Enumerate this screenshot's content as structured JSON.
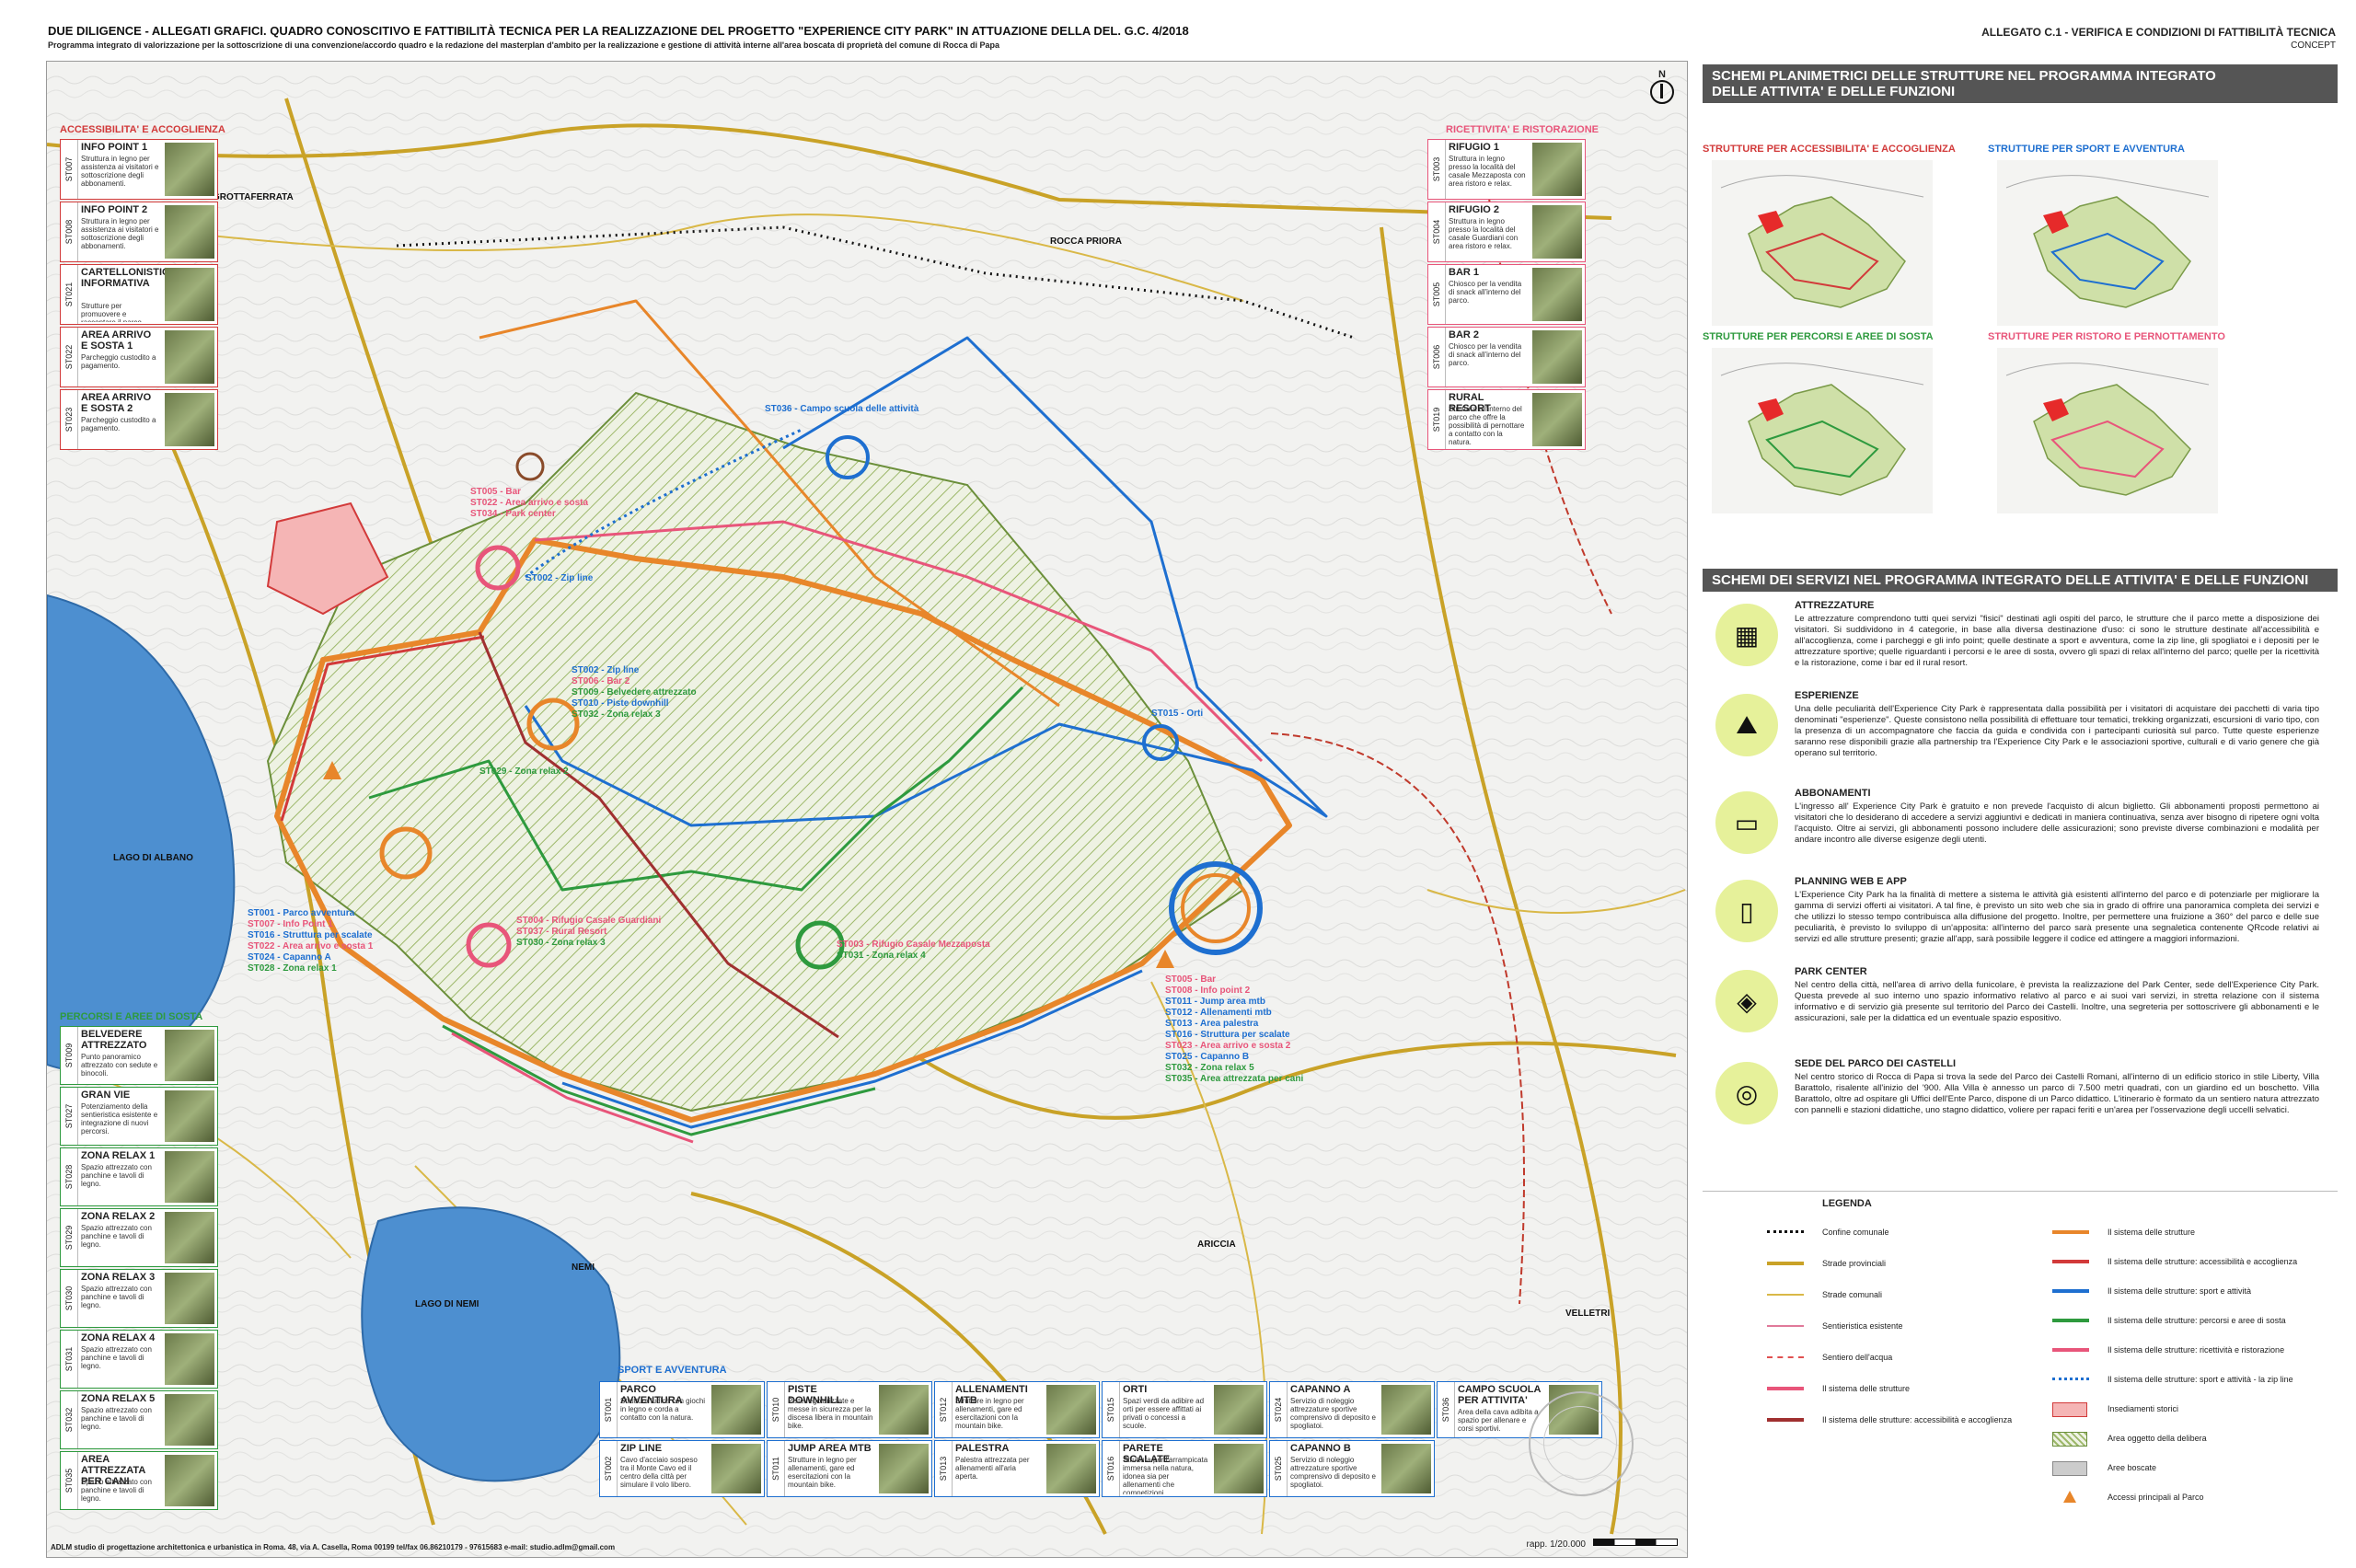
{
  "header": {
    "title": "DUE DILIGENCE - ALLEGATI GRAFICI. QUADRO CONOSCITIVO E FATTIBILITÀ TECNICA PER LA REALIZZAZIONE DEL PROGETTO \"EXPERIENCE CITY PARK\" IN ATTUAZIONE DELLA DEL. G.C. 4/2018",
    "subtitle": "Programma integrato di valorizzazione per la sottoscrizione di una convenzione/accordo quadro e la redazione del masterplan d'ambito per la realizzazione e gestione di attività interne all'area boscata di proprietà del comune di Rocca di Papa",
    "allegato": "ALLEGATO C.1 - VERIFICA E CONDIZIONI DI FATTIBILITÀ TECNICA",
    "concept": "CONCEPT"
  },
  "map": {
    "north": "N",
    "places": [
      "GROTTAFERRATA",
      "ROCCA PRIORA",
      "LAGO DI ALBANO",
      "ARICCIA",
      "NEMI",
      "LAGO DI NEMI",
      "VELLETRI"
    ],
    "annotations": [
      {
        "text": "ST005 - Bar",
        "color": "#e8557a"
      },
      {
        "text": "ST022 - Area arrivo e sosta",
        "color": "#e8557a"
      },
      {
        "text": "ST034 - Park center",
        "color": "#e8557a"
      },
      {
        "text": "ST002 - Zip line",
        "color": "#1e6fd0"
      },
      {
        "text": "ST036 - Campo scuola delle attività",
        "color": "#1e6fd0"
      },
      {
        "text": "ST002 - Zip line",
        "color": "#1e6fd0"
      },
      {
        "text": "ST006 - Bar 2",
        "color": "#e8557a"
      },
      {
        "text": "ST009 - Belvedere attrezzato",
        "color": "#2e9a3e"
      },
      {
        "text": "ST010 - Piste downhill",
        "color": "#1e6fd0"
      },
      {
        "text": "ST032 - Zona relax 3",
        "color": "#2e9a3e"
      },
      {
        "text": "ST029 - Zona relax 2",
        "color": "#2e9a3e"
      },
      {
        "text": "ST015 - Orti",
        "color": "#1e6fd0"
      },
      {
        "text": "ST001 - Parco avventura",
        "color": "#1e6fd0"
      },
      {
        "text": "ST007 - Info Point 1",
        "color": "#e8557a"
      },
      {
        "text": "ST016 - Struttura per scalate",
        "color": "#1e6fd0"
      },
      {
        "text": "ST022 - Area arrivo e sosta 1",
        "color": "#e8557a"
      },
      {
        "text": "ST024 - Capanno A",
        "color": "#1e6fd0"
      },
      {
        "text": "ST028 - Zona relax 1",
        "color": "#2e9a3e"
      },
      {
        "text": "ST004 - Rifugio Casale Guardiani",
        "color": "#e8557a"
      },
      {
        "text": "ST037 - Rural Resort",
        "color": "#e8557a"
      },
      {
        "text": "ST030 - Zona relax 3",
        "color": "#2e9a3e"
      },
      {
        "text": "ST003 - Rifugio Casale Mezzaposta",
        "color": "#e8557a"
      },
      {
        "text": "ST031 - Zona relax 4",
        "color": "#2e9a3e"
      },
      {
        "text": "ST005 - Bar",
        "color": "#e8557a"
      },
      {
        "text": "ST008 - Info point 2",
        "color": "#e8557a"
      },
      {
        "text": "ST011 - Jump area mtb",
        "color": "#1e6fd0"
      },
      {
        "text": "ST012 - Allenamenti mtb",
        "color": "#1e6fd0"
      },
      {
        "text": "ST013 - Area palestra",
        "color": "#1e6fd0"
      },
      {
        "text": "ST016 - Struttura per scalate",
        "color": "#1e6fd0"
      },
      {
        "text": "ST023 - Area arrivo e sosta 2",
        "color": "#e8557a"
      },
      {
        "text": "ST025 - Capanno B",
        "color": "#1e6fd0"
      },
      {
        "text": "ST032 - Zona relax 5",
        "color": "#2e9a3e"
      },
      {
        "text": "ST035 - Area attrezzata per cani",
        "color": "#2e9a3e"
      }
    ],
    "groups": {
      "accessibilita": {
        "title": "ACCESSIBILITA' E ACCOGLIENZA",
        "color": "#d23a3a",
        "cards": [
          {
            "code": "ST007",
            "title": "INFO POINT 1",
            "desc": "Struttura in legno per assistenza ai visitatori e sottoscrizione degli abbonamenti."
          },
          {
            "code": "ST008",
            "title": "INFO POINT 2",
            "desc": "Struttura in legno per assistenza ai visitatori e sottoscrizione degli abbonamenti."
          },
          {
            "code": "ST021",
            "title": "CARTELLONISTICA INFORMATIVA",
            "desc": "Strutture per promuovere e raccontare il parco."
          },
          {
            "code": "ST022",
            "title": "AREA ARRIVO E SOSTA 1",
            "desc": "Parcheggio custodito a pagamento."
          },
          {
            "code": "ST023",
            "title": "AREA ARRIVO E SOSTA 2",
            "desc": "Parcheggio custodito a pagamento."
          }
        ]
      },
      "ricettivita": {
        "title": "RICETTIVITA' E RISTORAZIONE",
        "color": "#e8557a",
        "cards": [
          {
            "code": "ST003",
            "title": "RIFUGIO 1",
            "desc": "Struttura in legno presso la località del casale Mezzaposta con area ristoro e relax."
          },
          {
            "code": "ST004",
            "title": "RIFUGIO 2",
            "desc": "Struttura in legno presso la località del casale Guardiani con area ristoro e relax."
          },
          {
            "code": "ST005",
            "title": "BAR 1",
            "desc": "Chiosco per la vendita di snack all'interno del parco."
          },
          {
            "code": "ST006",
            "title": "BAR 2",
            "desc": "Chiosco per la vendita di snack all'interno del parco."
          },
          {
            "code": "ST019",
            "title": "RURAL RESORT",
            "desc": "Struttura all'interno del parco che offre la possibilità di pernottare a contatto con la natura."
          }
        ]
      },
      "percorsi": {
        "title": "PERCORSI E AREE DI SOSTA",
        "color": "#2e9a3e",
        "cards": [
          {
            "code": "ST009",
            "title": "BELVEDERE ATTREZZATO",
            "desc": "Punto panoramico attrezzato con sedute e binocoli."
          },
          {
            "code": "ST027",
            "title": "GRAN VIE",
            "desc": "Potenziamento della sentieristica esistente e integrazione di nuovi percorsi."
          },
          {
            "code": "ST028",
            "title": "ZONA RELAX 1",
            "desc": "Spazio attrezzato con panchine e tavoli di legno."
          },
          {
            "code": "ST029",
            "title": "ZONA RELAX 2",
            "desc": "Spazio attrezzato con panchine e tavoli di legno."
          },
          {
            "code": "ST030",
            "title": "ZONA RELAX 3",
            "desc": "Spazio attrezzato con panchine e tavoli di legno."
          },
          {
            "code": "ST031",
            "title": "ZONA RELAX 4",
            "desc": "Spazio attrezzato con panchine e tavoli di legno."
          },
          {
            "code": "ST032",
            "title": "ZONA RELAX 5",
            "desc": "Spazio attrezzato con panchine e tavoli di legno."
          },
          {
            "code": "ST035",
            "title": "AREA ATTREZZATA PER CANI",
            "desc": "Spazio attrezzato con panchine e tavoli di legno."
          }
        ]
      },
      "sport": {
        "title": "SPORT E AVVENTURA",
        "color": "#1e6fd0",
        "cards": [
          {
            "code": "ST001",
            "title": "PARCO AVVENTURA",
            "desc": "Struttura ludica con giochi in legno e corda a contatto con la natura."
          },
          {
            "code": "ST002",
            "title": "ZIP LINE",
            "desc": "Cavo d'acciaio sospeso tra il Monte Cavo ed il centro della città per simulare il volo libero."
          },
          {
            "code": "ST010",
            "title": "PISTE DOWNHILL",
            "desc": "Piste regolarizzate e messe in sicurezza per la discesa libera in mountain bike."
          },
          {
            "code": "ST011",
            "title": "JUMP AREA MTB",
            "desc": "Strutture in legno per allenamenti, gare ed esercitazioni con la mountain bike."
          },
          {
            "code": "ST012",
            "title": "ALLENAMENTI MTB",
            "desc": "Strutture in legno per allenamenti, gare ed esercitazioni con la mountain bike."
          },
          {
            "code": "ST013",
            "title": "PALESTRA",
            "desc": "Palestra attrezzata per allenamenti all'aria aperta."
          },
          {
            "code": "ST015",
            "title": "ORTI",
            "desc": "Spazi verdi da adibire ad orti per essere affittati ai privati o concessi a scuole."
          },
          {
            "code": "ST016",
            "title": "PARETE SCALATE",
            "desc": "Struttura per l'arrampicata immersa nella natura, idonea sia per allenamenti che competizioni."
          },
          {
            "code": "ST024",
            "title": "CAPANNO A",
            "desc": "Servizio di noleggio attrezzature sportive comprensivo di deposito e spogliatoi."
          },
          {
            "code": "ST025",
            "title": "CAPANNO B",
            "desc": "Servizio di noleggio attrezzature sportive comprensivo di deposito e spogliatoi."
          },
          {
            "code": "ST036",
            "title": "CAMPO SCUOLA PER ATTIVITA'",
            "desc": "Area della cava adibita a spazio per allenare e corsi sportivi."
          }
        ]
      }
    },
    "footer_studio": "ADLM studio di progettazione architettonica e urbanistica in Roma. 48, via A. Casella, Roma 00199 tel/fax 06.86210179 - 97615683 e-mail: studio.adlm@gmail.com",
    "scale": "rapp. 1/20.000"
  },
  "right": {
    "schemi_title_1": "SCHEMI PLANIMETRICI DELLE STRUTTURE NEL PROGRAMMA INTEGRATO",
    "schemi_title_2": "DELLE ATTIVITA' E DELLE FUNZIONI",
    "mini_maps": [
      {
        "label": "STRUTTURE PER ACCESSIBILITA' E ACCOGLIENZA",
        "color": "#d23a3a"
      },
      {
        "label": "STRUTTURE PER SPORT E AVVENTURA",
        "color": "#1e6fd0"
      },
      {
        "label": "STRUTTURE PER PERCORSI E AREE DI SOSTA",
        "color": "#2e9a3e"
      },
      {
        "label": "STRUTTURE PER RISTORO E PERNOTTAMENTO",
        "color": "#e8557a"
      }
    ],
    "servizi_title": "SCHEMI DEI SERVIZI NEL PROGRAMMA INTEGRATO DELLE ATTIVITA' E DELLE FUNZIONI",
    "services": [
      {
        "title": "ATTREZZATURE",
        "icon": "market-stall-icon",
        "text": "Le attrezzature comprendono tutti quei servizi \"fisici\" destinati agli ospiti del parco, le strutture che il parco mette a disposizione dei visitatori. Si suddividono in 4 categorie, in base alla diversa destinazione d'uso: ci sono le strutture destinate all'accessibilità e all'accoglienza, come i parcheggi e gli info point; quelle destinate a sport e avventura, come la zip line, gli spogliatoi e i depositi per le attrezzature sportive; quelle riguardanti i percorsi e le aree di sosta, ovvero gli spazi di relax all'interno del parco; quelle per la ricettività e la ristorazione, come i bar ed il rural resort."
      },
      {
        "title": "ESPERIENZE",
        "icon": "hiker-icon",
        "text": "Una delle peculiarità dell'Experience City Park è rappresentata dalla possibilità per i visitatori di acquistare dei pacchetti di varia tipo denominati \"esperienze\". Queste consistono nella possibilità di effettuare tour tematici, trekking organizzati, escursioni di vario tipo, con la presenza di un accompagnatore che faccia da guida e condivida con i partecipanti curiosità sul parco. Tutte queste esperienze saranno rese disponibili grazie alla partnership tra l'Experience City Park e le associazioni sportive, culturali e di vario genere che già operano sul territorio."
      },
      {
        "title": "ABBONAMENTI",
        "icon": "cards-icon",
        "text": "L'ingresso all' Experience City Park è gratuito e non prevede l'acquisto di alcun biglietto. Gli abbonamenti proposti permettono ai visitatori che lo desiderano di accedere a servizi aggiuntivi e dedicati in maniera continuativa, senza aver bisogno di ripetere ogni volta l'acquisto. Oltre ai servizi, gli abbonamenti possono includere delle assicurazioni; sono previste diverse combinazioni e modalità per andare incontro alle diverse esigenze degli utenti."
      },
      {
        "title": "PLANNING WEB E APP",
        "icon": "smartphone-icon",
        "text": "L'Experience City Park ha la finalità di mettere a sistema le attività già esistenti all'interno del parco e di potenziarle per migliorare la gamma di servizi offerti ai visitatori. A tal fine, è previsto un sito web che sia in grado di offrire una panoramica completa dei servizi e che utilizzi lo stesso tempo contribuisca alla diffusione del progetto. Inoltre, per permettere una fruizione a 360° del parco e delle sue peculiarità, è previsto lo sviluppo di un'apposita: all'interno del parco sarà presente una segnaletica contenente QRcode relativi ai servizi ed alle strutture presenti; grazie all'app, sarà possibile leggere il codice ed attingere a maggiori informazioni."
      },
      {
        "title": "PARK CENTER",
        "icon": "park-center-icon",
        "text": "Nel centro della città, nell'area di arrivo della funicolare, è prevista la realizzazione del Park Center, sede dell'Experience City Park. Questa prevede al suo interno uno spazio informativo relativo al parco e ai suoi vari servizi, in stretta relazione con il sistema informativo e di servizio già presente sul territorio del Parco dei Castelli. Inoltre, una segreteria per sottoscrivere gli abbonamenti e le assicurazioni, sale per la didattica ed un eventuale spazio espositivo."
      },
      {
        "title": "SEDE DEL PARCO DEI CASTELLI",
        "icon": "parco-castelli-logo-icon",
        "text": "Nel centro storico di Rocca di Papa si trova la sede del Parco dei Castelli Romani, all'interno di un edificio storico in stile Liberty, Villa Barattolo, risalente all'inizio del '900. Alla Villa è annesso un parco di 7.500 metri quadrati, con un giardino ed un boschetto. Villa Barattolo, oltre ad ospitare gli Uffici dell'Ente Parco, dispone di un Parco didattico. L'itinerario è formato da un sentiero natura attrezzato con pannelli e stazioni didattiche, uno stagno didattico, voliere per rapaci feriti e un'area per l'osservazione degli uccelli selvatici."
      }
    ],
    "legenda_title": "LEGENDA",
    "legend_left": [
      {
        "label": "Confine comunale",
        "color": "#111111",
        "style": "dotted"
      },
      {
        "label": "Strade provinciali",
        "color": "#c9a227",
        "style": "thick"
      },
      {
        "label": "Strade comunali",
        "color": "#d9b847",
        "style": "thin"
      },
      {
        "label": "Sentieristica esistente",
        "color": "#e07a9a",
        "style": "thin"
      },
      {
        "label": "Sentiero dell'acqua",
        "color": "#e05050",
        "style": "dashed"
      },
      {
        "label": "Il sistema delle strutture",
        "color": "#e8557a",
        "style": "thick"
      },
      {
        "label": "Il sistema delle strutture: accessibilità e accoglienza",
        "color": "#a03030",
        "style": "thick"
      }
    ],
    "legend_right": [
      {
        "label": "Il sistema delle strutture",
        "color": "#e8862a",
        "style": "thick"
      },
      {
        "label": "Il sistema delle strutture: accessibilità e accoglienza",
        "color": "#d23a3a",
        "style": "thick"
      },
      {
        "label": "Il sistema delle strutture: sport e attività",
        "color": "#1e6fd0",
        "style": "thick"
      },
      {
        "label": "Il sistema delle strutture: percorsi e aree di sosta",
        "color": "#2e9a3e",
        "style": "thick"
      },
      {
        "label": "Il sistema delle strutture: ricettività e ristorazione",
        "color": "#e8557a",
        "style": "thick"
      },
      {
        "label": "Il sistema delle strutture: sport e attività - la zip line",
        "color": "#1e6fd0",
        "style": "dotted"
      },
      {
        "label": "Insediamenti storici",
        "color": "#f5b5b5",
        "style": "box-red"
      },
      {
        "label": "Area oggetto della delibera",
        "color": "#b8d68a",
        "style": "box-hatch"
      },
      {
        "label": "Aree boscate",
        "color": "#cccccc",
        "style": "box-grey"
      },
      {
        "label": "Accessi principali al Parco",
        "color": "#e8862a",
        "style": "triangle"
      }
    ]
  },
  "colors": {
    "accessibilita": "#d23a3a",
    "sport": "#1e6fd0",
    "percorsi": "#2e9a3e",
    "ricettivita": "#e8557a",
    "strutture": "#e8862a",
    "road_provinciale": "#c9a227",
    "road_comunale": "#d9b847",
    "lake": "#4d8fd0",
    "area_fill": "#dde8c8",
    "bg_map": "#f4f4f2"
  }
}
